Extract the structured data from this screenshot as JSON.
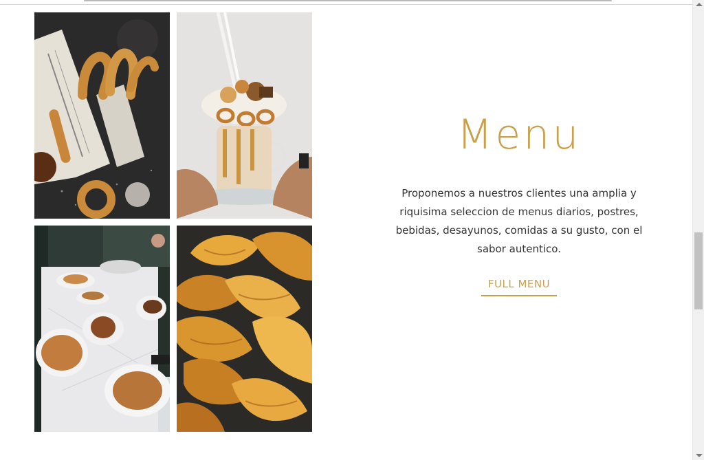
{
  "menu": {
    "title": "Menu",
    "description": "Proponemos a nuestros clientes una amplia y riquisima seleccion de menus diarios, postres, bebidas, desayunos, comidas a su gusto, con el sabor autentico.",
    "button_label": "FULL MENU"
  },
  "gallery": {
    "tiles": [
      {
        "name": "churros-photo"
      },
      {
        "name": "milkshake-photo"
      },
      {
        "name": "pastry-table-photo"
      },
      {
        "name": "croissants-photo"
      }
    ]
  },
  "colors": {
    "accent": "#c9a04b",
    "text": "#333333",
    "background": "#ffffff"
  },
  "scrollbar": {
    "position": 0.51
  }
}
